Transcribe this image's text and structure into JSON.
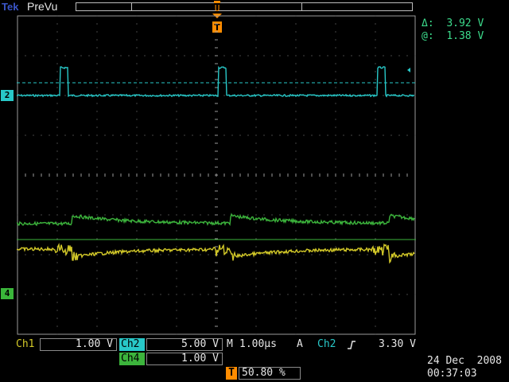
{
  "header": {
    "brand": "Tek",
    "mode": "PreVu"
  },
  "cursors": {
    "delta_symbol": "Δ:",
    "delta_value": "3.92 V",
    "at_symbol": "@:",
    "at_value": "1.38 V"
  },
  "channel_markers": {
    "ch2": "2",
    "ch4": "4"
  },
  "readouts": {
    "ch1_label": "Ch1",
    "ch1_scale": "1.00 V",
    "ch2_label": "Ch2",
    "ch2_scale": "5.00 V",
    "horizontal_label": "M",
    "horizontal_scale": "1.00µs",
    "trigger_source_prefix": "A",
    "trigger_source": "Ch2",
    "trigger_level": "3.30 V",
    "ch4_label": "Ch4",
    "ch4_scale": "1.00 V",
    "trigger_position_label": "T",
    "trigger_position": "50.80 %"
  },
  "datetime": {
    "date": "24 Dec  2008",
    "time": "00:37:03"
  },
  "colors": {
    "ch1": "#d2c828",
    "ch2": "#28c8c8",
    "ch4": "#3cb43c",
    "trigger": "#ff8c00",
    "graticule": "#9a9a9a"
  }
}
